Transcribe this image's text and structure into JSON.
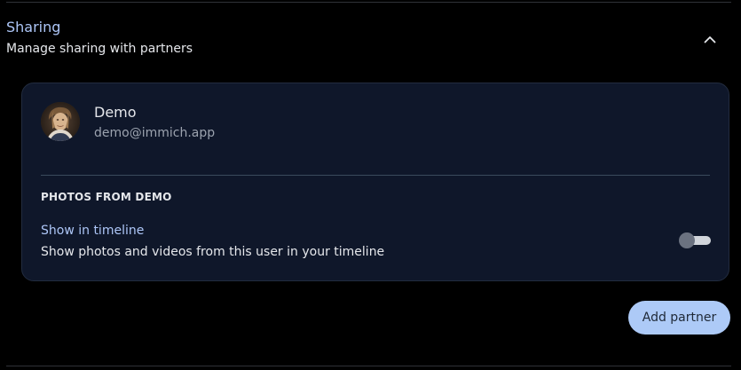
{
  "section": {
    "title": "Sharing",
    "subtitle": "Manage sharing with partners"
  },
  "partner": {
    "name": "Demo",
    "email": "demo@immich.app",
    "photos_from_label": "PHOTOS FROM DEMO",
    "setting": {
      "title": "Show in timeline",
      "description": "Show photos and videos from this user in your timeline",
      "enabled": false
    }
  },
  "actions": {
    "add_partner_label": "Add partner"
  },
  "icons": {
    "collapse": "chevron-up-icon",
    "avatar": "avatar"
  },
  "colors": {
    "background": "#000000",
    "card": "#0f172a",
    "accent": "#adc6f7",
    "button": "#adcaf7"
  }
}
